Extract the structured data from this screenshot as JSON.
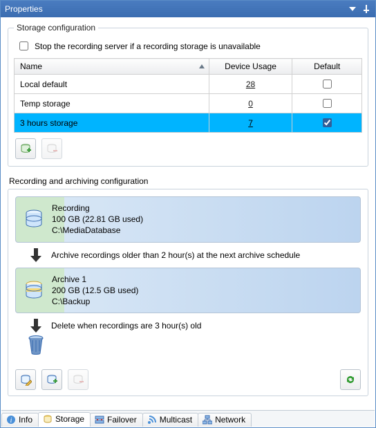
{
  "window": {
    "title": "Properties"
  },
  "storage_config": {
    "legend": "Storage configuration",
    "stop_checkbox_label": "Stop the recording server if a recording storage is unavailable",
    "stop_checked": false,
    "columns": {
      "name": "Name",
      "usage": "Device Usage",
      "default": "Default"
    },
    "rows": [
      {
        "name": "Local default",
        "usage": "28",
        "default": false,
        "selected": false
      },
      {
        "name": "Temp storage",
        "usage": "0",
        "default": false,
        "selected": false
      },
      {
        "name": "3 hours storage",
        "usage": "7",
        "default": true,
        "selected": true
      }
    ]
  },
  "recording_config": {
    "legend": "Recording and archiving configuration",
    "recording": {
      "title": "Recording",
      "size": "100 GB (22.81 GB used)",
      "path": "C:\\MediaDatabase"
    },
    "archive_rule": "Archive recordings older than 2 hour(s) at the next archive schedule",
    "archive": {
      "title": "Archive 1",
      "size": "200 GB (12.5 GB used)",
      "path": "C:\\Backup"
    },
    "delete_rule": "Delete when recordings are 3 hour(s) old"
  },
  "tabs": [
    {
      "id": "info",
      "label": "Info",
      "active": false
    },
    {
      "id": "storage",
      "label": "Storage",
      "active": true
    },
    {
      "id": "failover",
      "label": "Failover",
      "active": false
    },
    {
      "id": "multicast",
      "label": "Multicast",
      "active": false
    },
    {
      "id": "network",
      "label": "Network",
      "active": false
    }
  ]
}
